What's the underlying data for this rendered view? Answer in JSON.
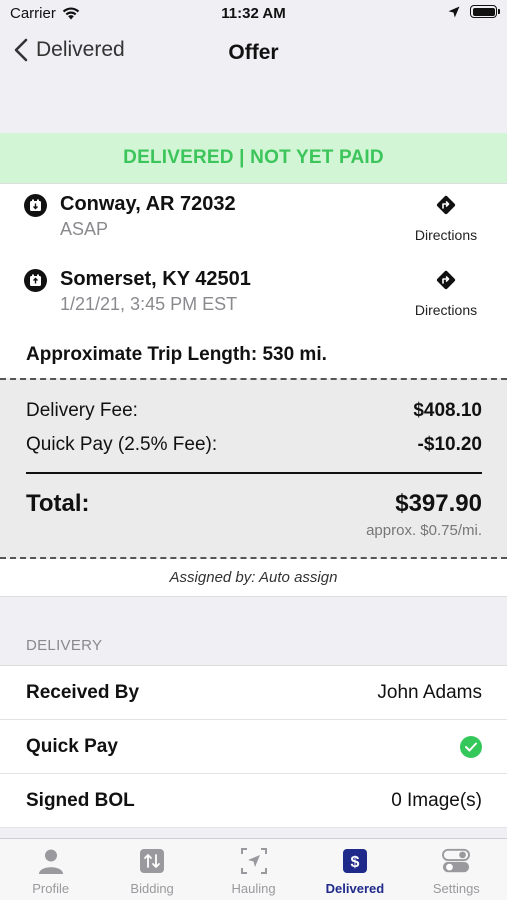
{
  "status_bar": {
    "carrier": "Carrier",
    "time": "11:32 AM"
  },
  "nav": {
    "back_label": "Delivered",
    "title": "Offer"
  },
  "banner": "DELIVERED | NOT YET PAID",
  "stops": [
    {
      "city": "Conway, AR 72032",
      "when": "ASAP",
      "directions_label": "Directions"
    },
    {
      "city": "Somerset, KY 42501",
      "when": "1/21/21, 3:45 PM EST",
      "directions_label": "Directions"
    }
  ],
  "trip_length": "Approximate Trip Length: 530 mi.",
  "fees": {
    "delivery_fee_label": "Delivery Fee:",
    "delivery_fee_value": "$408.10",
    "quick_pay_label": "Quick Pay (2.5% Fee):",
    "quick_pay_value": "-$10.20",
    "total_label": "Total:",
    "total_value": "$397.90",
    "per_mile": "approx. $0.75/mi."
  },
  "assigned_by": "Assigned by: Auto assign",
  "delivery_section": {
    "header": "DELIVERY",
    "rows": [
      {
        "label": "Received By",
        "value": "John Adams"
      },
      {
        "label": "Quick Pay",
        "value": ""
      },
      {
        "label": "Signed BOL",
        "value": "0 Image(s)"
      }
    ]
  },
  "tabs": [
    {
      "label": "Profile",
      "icon": "person-icon"
    },
    {
      "label": "Bidding",
      "icon": "bidding-icon"
    },
    {
      "label": "Hauling",
      "icon": "navigation-icon"
    },
    {
      "label": "Delivered",
      "icon": "dollar-icon"
    },
    {
      "label": "Settings",
      "icon": "toggles-icon"
    }
  ],
  "colors": {
    "banner_bg": "#d2f5d5",
    "banner_text": "#3cc55a",
    "active_tab": "#1f2a8a",
    "check": "#34c759"
  }
}
